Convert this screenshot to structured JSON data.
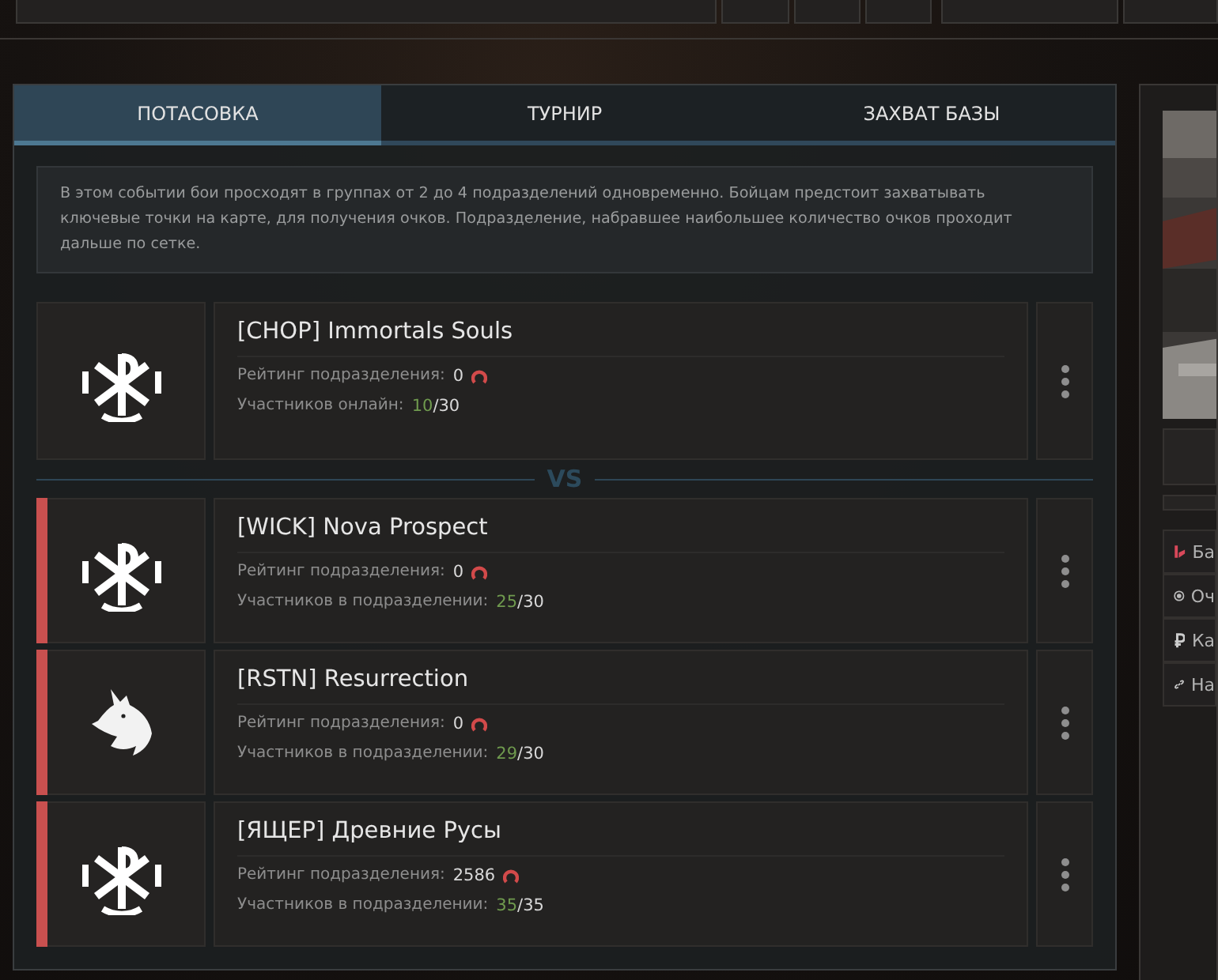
{
  "tabs": [
    {
      "label": "ПОТАСОВКА",
      "selected": true
    },
    {
      "label": "ТУРНИР",
      "selected": false
    },
    {
      "label": "ЗАХВАТ БАЗЫ",
      "selected": false
    }
  ],
  "description": "В этом событии бои просходят в группах от 2 до 4 подразделений одновременно. Бойцам предстоит захватывать ключевые точки на карте, для получения очков. Подразделение, набравшее наибольшее количество очков проходит дальше по сетке.",
  "own_team": {
    "kind": "chi-rho",
    "name": "[CHOP] Immortals Souls",
    "rating_label": "Рейтинг подразделения:",
    "rating": "0",
    "members_label": "Участников онлайн:",
    "members_current": "10",
    "members_separator": "/",
    "members_max": "30",
    "highlighted": false
  },
  "vs_label": "VS",
  "opponents": [
    {
      "kind": "chi-rho",
      "name": "[WICK] Nova Prospect",
      "rating_label": "Рейтинг подразделения:",
      "rating": "0",
      "members_label": "Участников в подразделении:",
      "members_current": "25",
      "members_separator": "/",
      "members_max": "30",
      "highlighted": true
    },
    {
      "kind": "wolf",
      "name": "[RSTN] Resurrection",
      "rating_label": "Рейтинг подразделения:",
      "rating": "0",
      "members_label": "Участников в подразделении:",
      "members_current": "29",
      "members_separator": "/",
      "members_max": "30",
      "highlighted": true
    },
    {
      "kind": "chi-rho",
      "name": "[ЯЩЕР] Древние Русы",
      "rating_label": "Рейтинг подразделения:",
      "rating": "2586",
      "members_label": "Участников в подразделении:",
      "members_current": "35",
      "members_separator": "/",
      "members_max": "35",
      "highlighted": true
    }
  ],
  "side_panel": {
    "items": [
      {
        "kind": "cartridges",
        "label": "Ба"
      },
      {
        "kind": "points",
        "label": "Оч"
      },
      {
        "kind": "ruble",
        "label": "Ка"
      },
      {
        "kind": "link",
        "label": "На"
      }
    ]
  }
}
